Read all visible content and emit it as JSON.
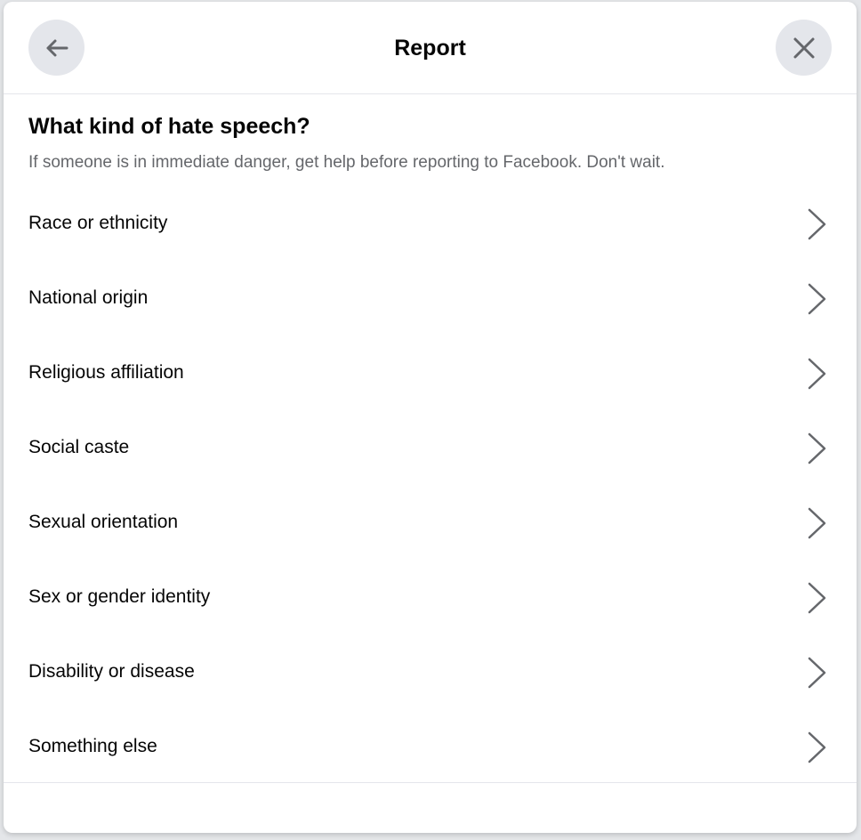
{
  "header": {
    "title": "Report",
    "back_icon": "arrow-left-icon",
    "close_icon": "close-icon"
  },
  "main": {
    "question": "What kind of hate speech?",
    "hint": "If someone is in immediate danger, get help before reporting to Facebook. Don't wait.",
    "options": [
      {
        "label": "Race or ethnicity"
      },
      {
        "label": "National origin"
      },
      {
        "label": "Religious affiliation"
      },
      {
        "label": "Social caste"
      },
      {
        "label": "Sexual orientation"
      },
      {
        "label": "Sex or gender identity"
      },
      {
        "label": "Disability or disease"
      },
      {
        "label": "Something else"
      }
    ]
  },
  "colors": {
    "text_primary": "#050505",
    "text_secondary": "#65676b",
    "button_bg": "#e4e6eb",
    "divider": "#e4e6eb",
    "chevron": "#65676b"
  }
}
